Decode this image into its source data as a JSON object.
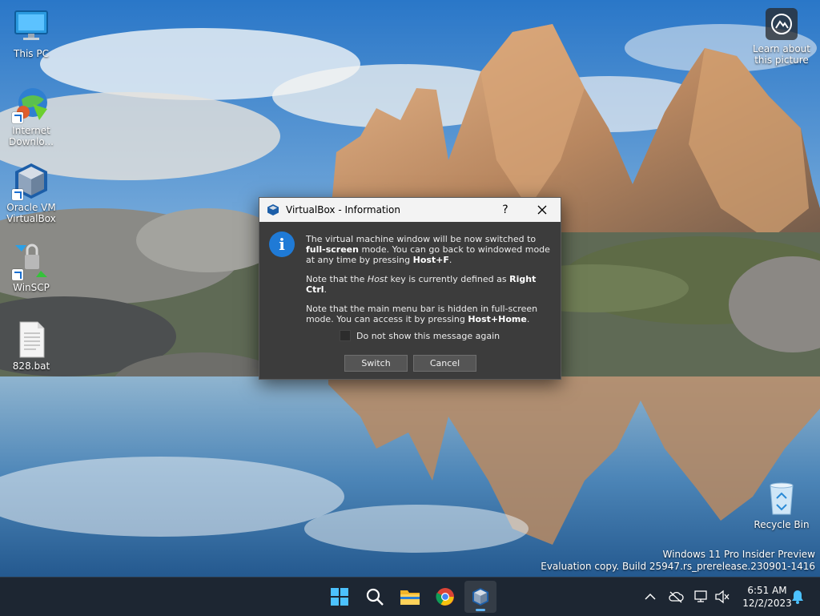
{
  "desktop": {
    "icons": [
      {
        "label": "This PC",
        "icon": "monitor-icon"
      },
      {
        "label": "Internet\nDownlo...",
        "icon": "internet-download-manager-icon"
      },
      {
        "label": "Oracle VM\nVirtualBox",
        "icon": "virtualbox-icon"
      },
      {
        "label": "WinSCP",
        "icon": "winscp-icon"
      },
      {
        "label": "828.bat",
        "icon": "batch-file-icon"
      },
      {
        "label": "Recycle Bin",
        "icon": "recycle-bin-icon"
      }
    ],
    "learn_about": {
      "label": "Learn about\nthis picture",
      "icon": "camera-icon"
    },
    "watermark": {
      "line1": "Windows 11 Pro Insider Preview",
      "line2": "Evaluation copy. Build 25947.rs_prerelease.230901-1416"
    }
  },
  "dialog": {
    "title": "VirtualBox - Information",
    "help_label": "?",
    "icon": "information-icon",
    "p1_a": "The virtual machine window will be now switched to ",
    "p1_b": "full-screen",
    "p1_c": " mode. You can go back to windowed mode at any time by pressing ",
    "p1_d": "Host+F",
    "p1_e": ".",
    "p2_a": "Note that the ",
    "p2_b": "Host",
    "p2_c": " key is currently defined as ",
    "p2_d": "Right Ctrl",
    "p2_e": ".",
    "p3_a": "Note that the main menu bar is hidden in full-screen mode. You can access it by pressing ",
    "p3_b": "Host+Home",
    "p3_c": ".",
    "checkbox_label": "Do not show this message again",
    "checkbox_checked": false,
    "switch_label": "Switch",
    "cancel_label": "Cancel"
  },
  "taskbar": {
    "apps": [
      "start-icon",
      "search-icon",
      "file-explorer-icon",
      "chrome-icon",
      "virtualbox-icon"
    ],
    "active_app": "virtualbox-icon",
    "tray": [
      "chevron-up-icon",
      "cloud-offline-icon",
      "network-icon",
      "volume-muted-icon",
      "notification-bell-icon"
    ],
    "time": "6:51 AM",
    "date": "12/2/2023"
  },
  "colors": {
    "dialog_bg": "#3c3c3c",
    "titlebar_bg": "#f3f3f3",
    "info_blue": "#1f7ad6",
    "taskbar_bg": "#1d2632",
    "active_indicator": "#5fb2f2"
  }
}
